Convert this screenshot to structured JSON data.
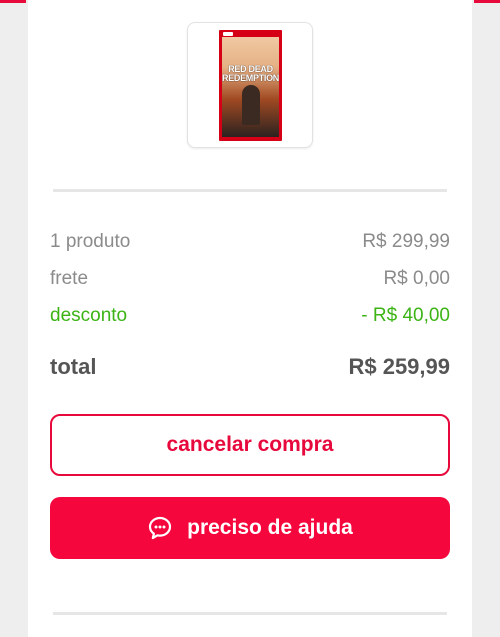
{
  "product": {
    "image_alt": "Red Dead Redemption",
    "cover_title_line1": "RED DEAD",
    "cover_title_line2": "REDEMPTION"
  },
  "summary": {
    "products_label": "1 produto",
    "products_value": "R$ 299,99",
    "shipping_label": "frete",
    "shipping_value": "R$ 0,00",
    "discount_label": "desconto",
    "discount_value": "- R$ 40,00",
    "total_label": "total",
    "total_value": "R$ 259,99"
  },
  "actions": {
    "cancel_label": "cancelar compra",
    "help_label": "preciso de ajuda",
    "help_icon": "chat-bubble-icon"
  },
  "colors": {
    "accent": "#e8093c",
    "discount": "#3cb416"
  }
}
